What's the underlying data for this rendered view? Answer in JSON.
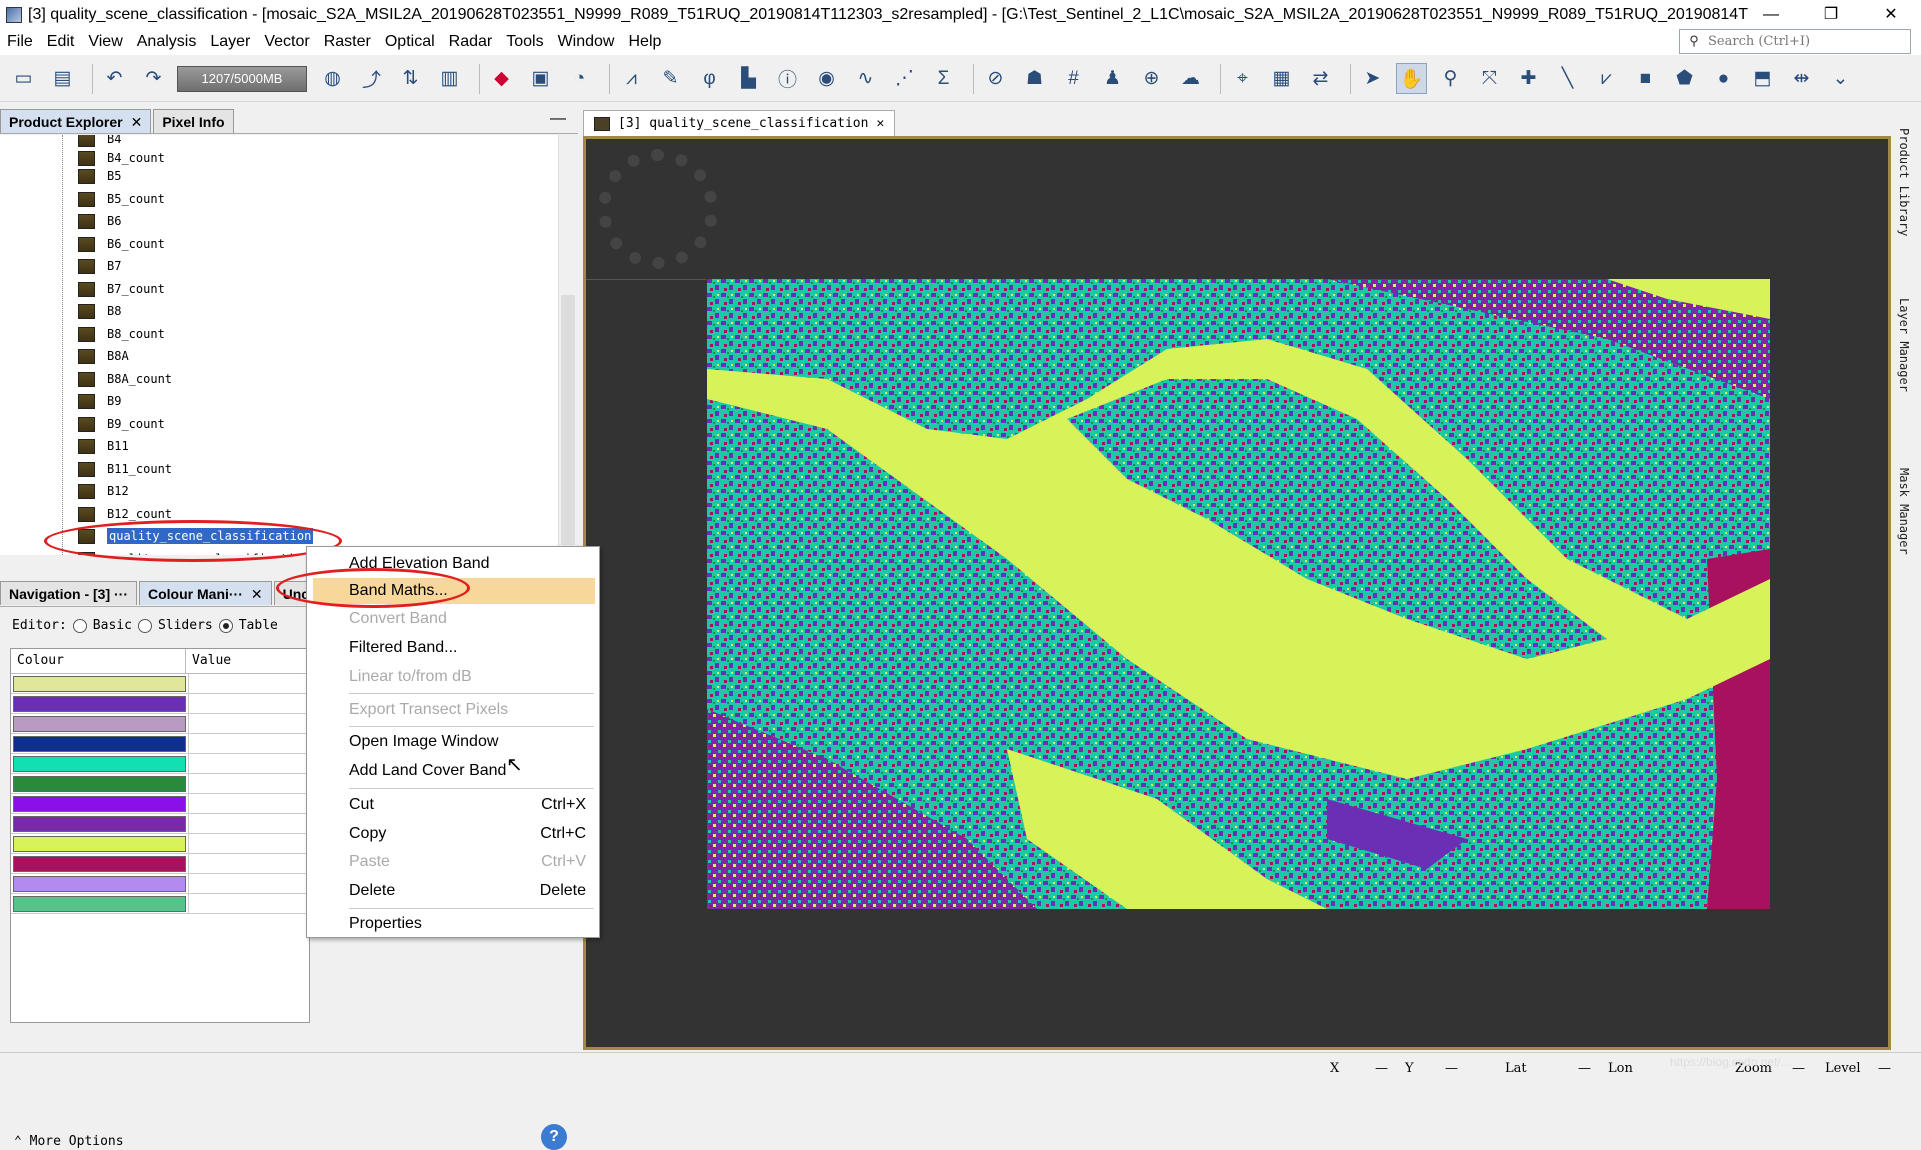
{
  "window": {
    "title": "[3] quality_scene_classification - [mosaic_S2A_MSIL2A_20190628T023551_N9999_R089_T51RUQ_20190814T112303_s2resampled] - [G:\\Test_Sentinel_2_L1C\\mosaic_S2A_MSIL2A_20190628T023551_N9999_R089_T51RUQ_20190814T11...",
    "minimize": "—",
    "restore": "❐",
    "close": "✕"
  },
  "menubar": {
    "items": [
      "File",
      "Edit",
      "View",
      "Analysis",
      "Layer",
      "Vector",
      "Raster",
      "Optical",
      "Radar",
      "Tools",
      "Window",
      "Help"
    ],
    "search_placeholder": "Search (Ctrl+I)"
  },
  "toolbar": {
    "memory": "1207/5000MB"
  },
  "left_panel": {
    "tabs": [
      "Product Explorer",
      "Pixel Info"
    ],
    "tree_items": [
      "B4",
      "B4_count",
      "B5",
      "B5_count",
      "B6",
      "B6_count",
      "B7",
      "B7_count",
      "B8",
      "B8_count",
      "B8A",
      "B8A_count",
      "B9",
      "B9_count",
      "B11",
      "B11_count",
      "B12",
      "B12_count",
      "quality_scene_classification",
      "quality_scene_classificati"
    ],
    "selected_item": "quality_scene_classification"
  },
  "lower_panel": {
    "tabs": [
      "Navigation - [3] ···",
      "Colour Mani···",
      "Unce"
    ],
    "editor_label": "Editor:",
    "editor_options": [
      "Basic",
      "Sliders",
      "Table"
    ],
    "editor_selected": "Table",
    "table_headers": [
      "Colour",
      "Value"
    ],
    "colours": [
      "#e1e79a",
      "#6a2fb5",
      "#b89ac2",
      "#0f2f8f",
      "#12e0b2",
      "#2a8a3c",
      "#8a0fe8",
      "#7a2aa8",
      "#d8f25a",
      "#a8115e",
      "#b38af0",
      "#56c48a"
    ],
    "more_options": "More Options"
  },
  "context_menu": {
    "items": [
      {
        "label": "Add Elevation Band",
        "shortcut": "",
        "enabled": true
      },
      {
        "label": "Band Maths...",
        "shortcut": "",
        "enabled": true,
        "highlight": true
      },
      {
        "label": "Convert Band",
        "shortcut": "",
        "enabled": false
      },
      {
        "label": "Filtered Band...",
        "shortcut": "",
        "enabled": true
      },
      {
        "label": "Linear to/from dB",
        "shortcut": "",
        "enabled": false
      },
      {
        "label": "Export Transect Pixels",
        "shortcut": "",
        "enabled": false
      },
      {
        "label": "Open Image Window",
        "shortcut": "",
        "enabled": true
      },
      {
        "label": "Add Land Cover Band",
        "shortcut": "",
        "enabled": true
      },
      {
        "label": "Cut",
        "shortcut": "Ctrl+X",
        "enabled": true
      },
      {
        "label": "Copy",
        "shortcut": "Ctrl+C",
        "enabled": true
      },
      {
        "label": "Paste",
        "shortcut": "Ctrl+V",
        "enabled": false
      },
      {
        "label": "Delete",
        "shortcut": "Delete",
        "enabled": true
      },
      {
        "label": "Properties",
        "shortcut": "",
        "enabled": true
      }
    ]
  },
  "image_view": {
    "tab_label": "[3] quality_scene_classification",
    "tab_close": "✕"
  },
  "right_strip": {
    "labels": [
      "Product Library",
      "Layer Manager",
      "Mask Manager"
    ]
  },
  "statusbar": {
    "x": "X",
    "y": "Y",
    "lat": "Lat",
    "lon": "Lon",
    "zoom": "Zoom",
    "level": "Level",
    "dash": "—"
  },
  "watermark": "https://blog.csdn.net/..."
}
